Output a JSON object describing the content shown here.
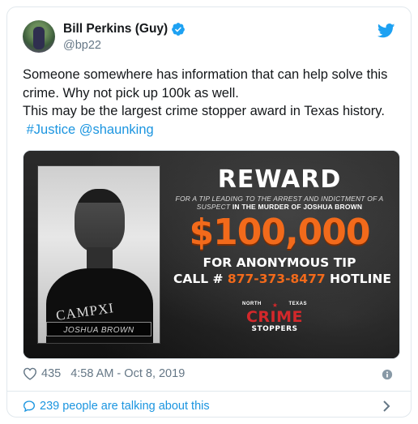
{
  "author": {
    "display_name": "Bill Perkins (Guy)",
    "handle": "@bp22",
    "verified": true
  },
  "tweet": {
    "line1": "Someone somewhere has information that can help solve this",
    "line2": "crime. Why not pick up 100k as well.",
    "line3": "This may be the largest crime stopper award in Texas history.",
    "hashtag": "#Justice",
    "mention": "@shaunking"
  },
  "media": {
    "photo_caption": "JOSHUA BROWN",
    "shirt_text": "CAMPXI",
    "title": "REWARD",
    "subtitle_line1": "FOR A TIP LEADING TO THE ARREST AND INDICTMENT OF A",
    "subtitle_line2_prefix": "SUSPECT",
    "subtitle_line2_bold": "IN THE MURDER OF JOSHUA BROWN",
    "amount": "$100,000",
    "line_anonymous": "FOR ANONYMOUS TIP",
    "line_call_prefix": "CALL #",
    "phone": "877-373-8477",
    "line_call_suffix": "HOTLINE",
    "logo_top_left": "NORTH",
    "logo_top_right": "TEXAS",
    "logo_crime": "CRIME",
    "logo_bottom": "STOPPERS"
  },
  "meta": {
    "likes": "435",
    "timestamp": "4:58 AM - Oct 8, 2019"
  },
  "footer": {
    "talking": "239 people are talking about this"
  },
  "colors": {
    "link": "#1b95e0",
    "reward_orange": "#f26a1b",
    "crime_red": "#d3282b"
  },
  "icons": [
    "verified-badge-icon",
    "twitter-bird-icon",
    "heart-icon",
    "info-icon",
    "speech-bubble-icon",
    "chevron-right-icon"
  ]
}
